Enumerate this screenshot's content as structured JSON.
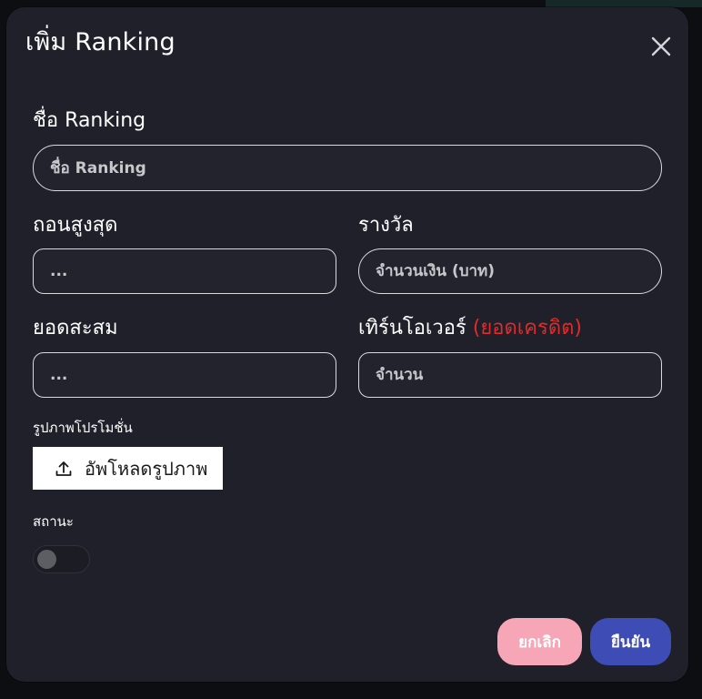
{
  "dialog": {
    "title": "เพิ่ม Ranking",
    "close_icon": "close-icon"
  },
  "form": {
    "ranking_name": {
      "label": "ชื่อ Ranking",
      "placeholder": "ชื่อ Ranking",
      "value": ""
    },
    "max_withdraw": {
      "label": "ถอนสูงสุด",
      "placeholder": "...",
      "value": ""
    },
    "reward": {
      "label": "รางวัล",
      "placeholder": "จำนวนเงิน (บาท)",
      "value": ""
    },
    "accumulated": {
      "label": "ยอดสะสม",
      "placeholder": "...",
      "value": ""
    },
    "turnover": {
      "label": "เทิร์นโอเวอร์",
      "label_note": "(ยอดเครดิต)",
      "placeholder": "จำนวน",
      "value": ""
    },
    "promo_image": {
      "label": "รูปภาพโปรโมชั่น",
      "button_label": "อัพโหลดรูปภาพ",
      "icon": "upload-icon"
    },
    "status": {
      "label": "สถานะ",
      "enabled": false
    }
  },
  "actions": {
    "cancel_label": "ยกเลิก",
    "confirm_label": "ยืนยัน"
  },
  "colors": {
    "modal_bg": "#1f2029",
    "warning_text": "#e02b2b",
    "cancel_button": "#f6a6b6",
    "confirm_button": "#3e4cb5"
  }
}
